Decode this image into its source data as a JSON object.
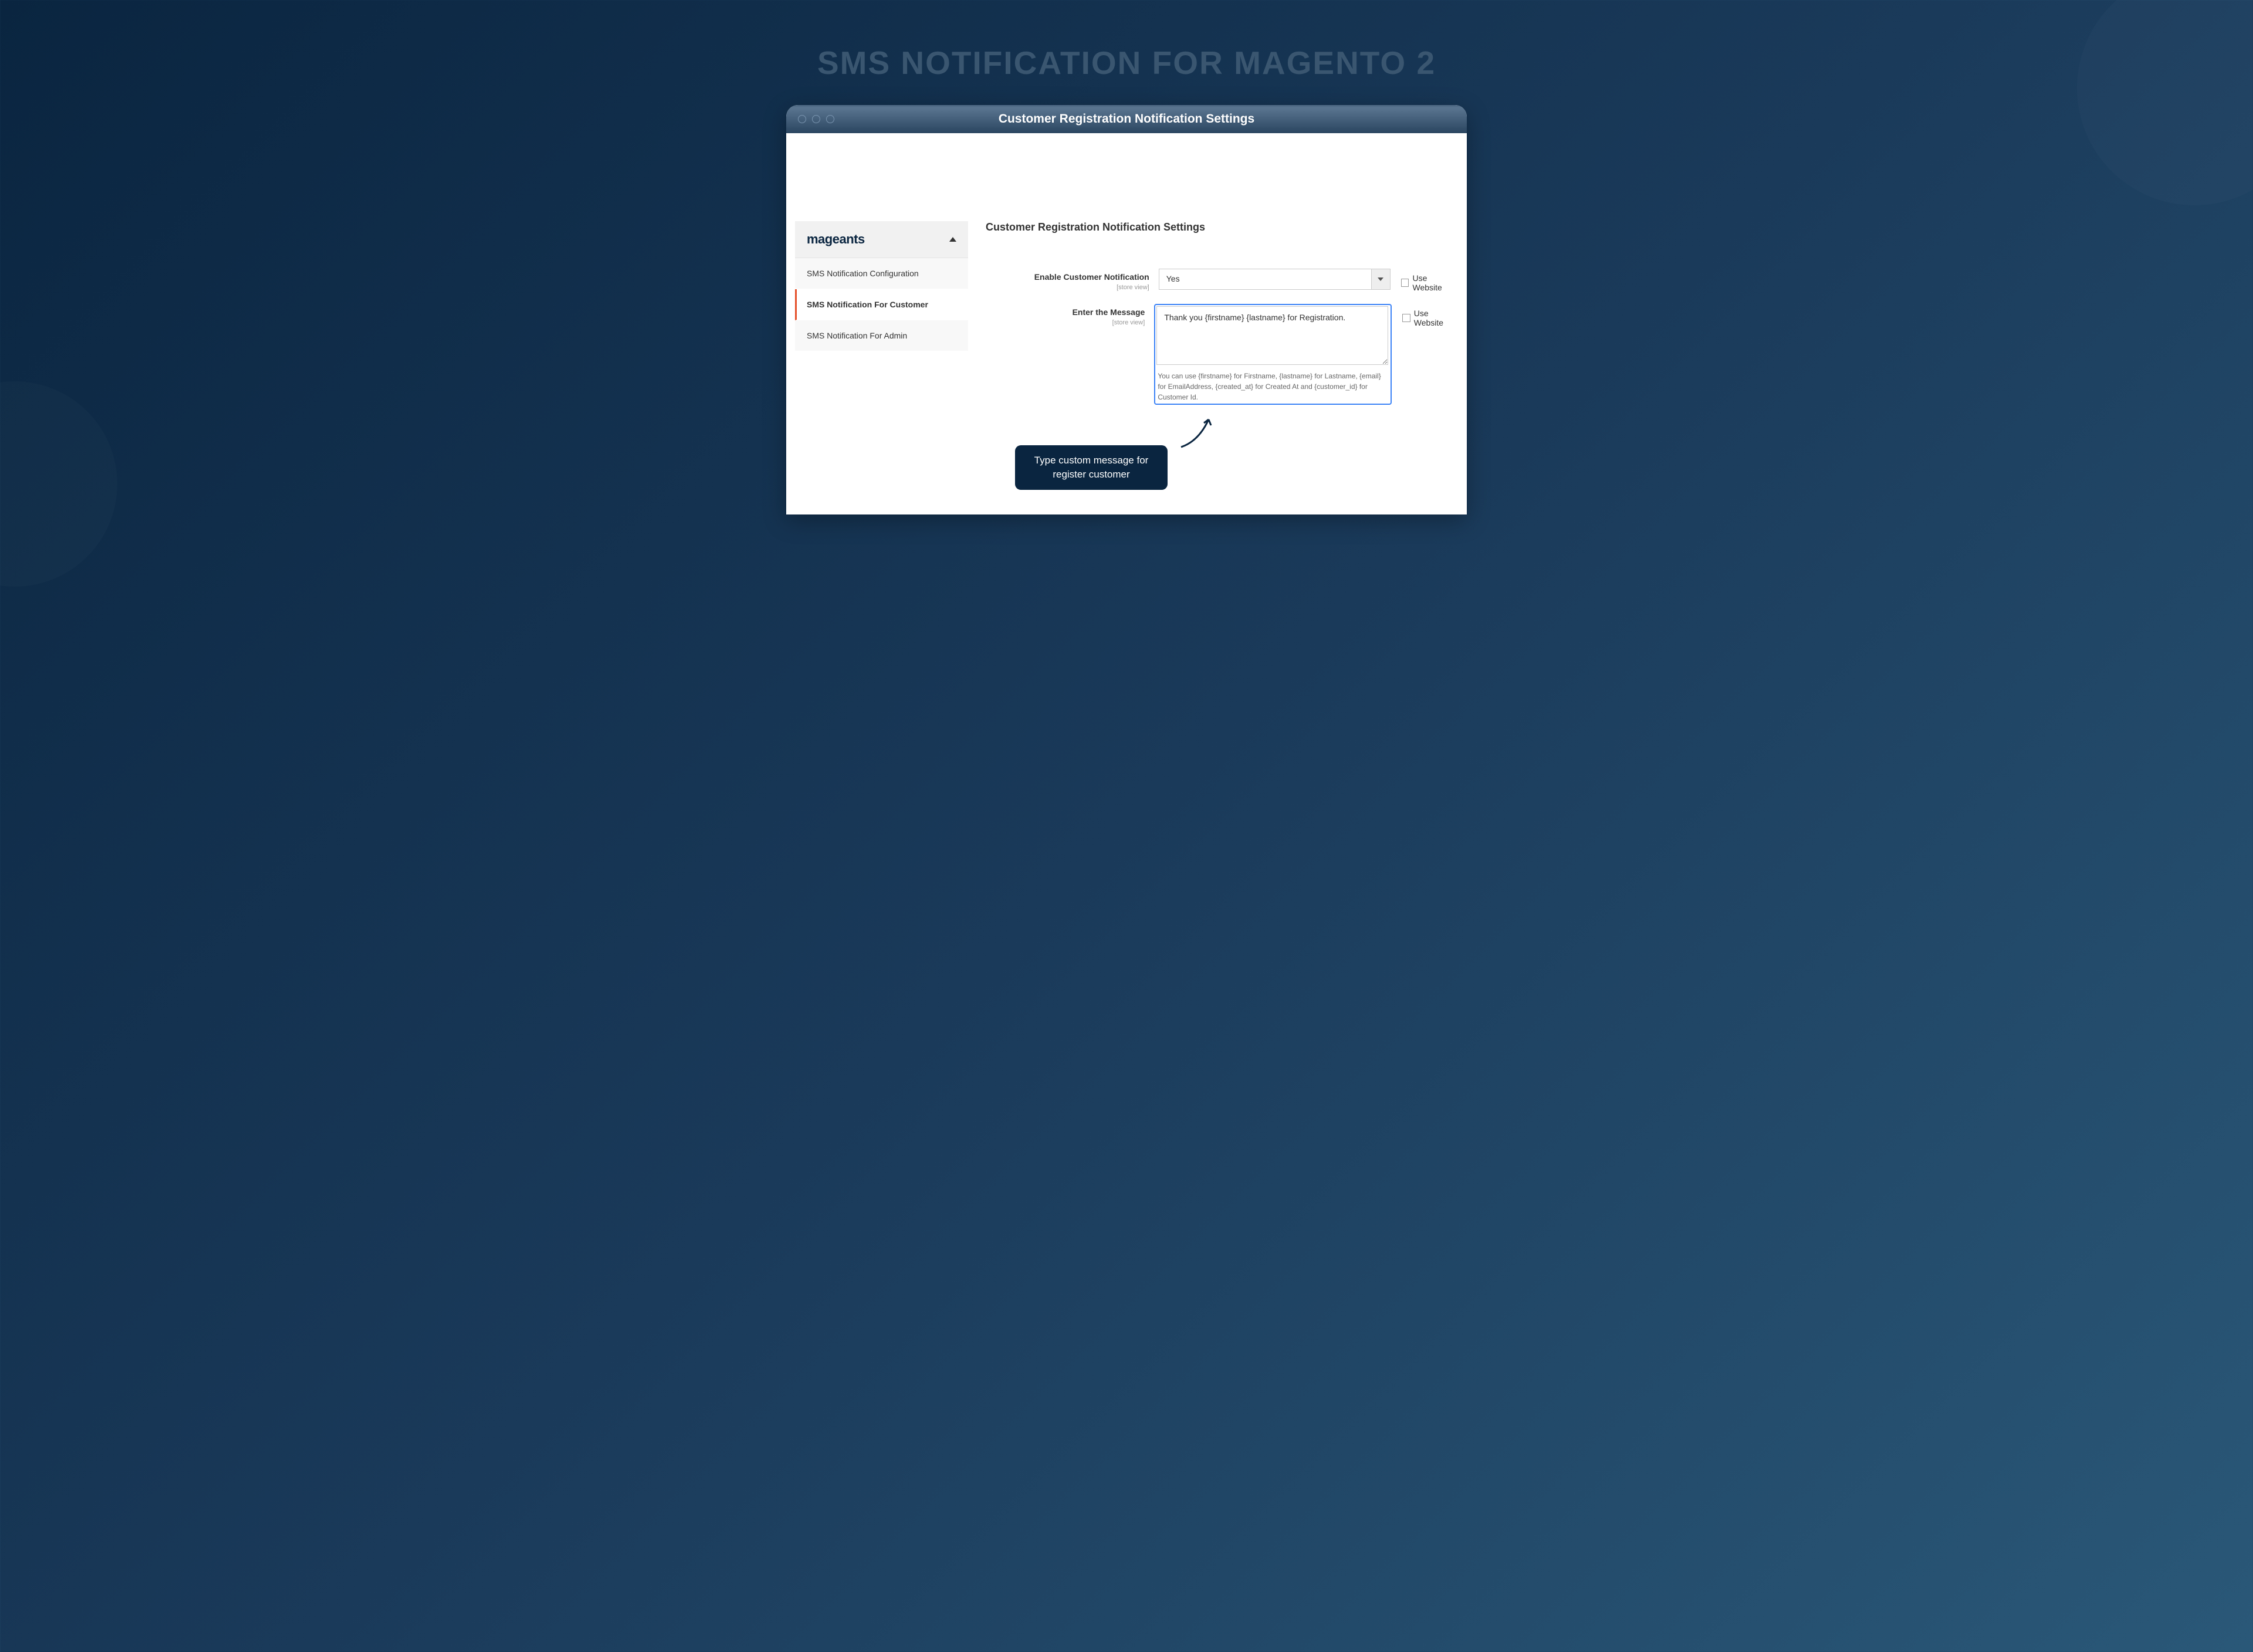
{
  "hero_title": "SMS NOTIFICATION FOR MAGENTO 2",
  "window_title": "Customer Registration Notification Settings",
  "brand": "mageants",
  "sidebar": {
    "items": [
      {
        "label": "SMS Notification Configuration"
      },
      {
        "label": "SMS Notification For Customer"
      },
      {
        "label": "SMS Notification For Admin"
      }
    ]
  },
  "section_heading": "Customer Registration Notification Settings",
  "fields": {
    "enable": {
      "label": "Enable Customer Notification",
      "scope": "[store view]",
      "value": "Yes",
      "use_website": "Use Website"
    },
    "message": {
      "label": "Enter the Message",
      "scope": "[store view]",
      "value": "Thank you {firstname} {lastname} for Registration.",
      "help": "You can use {firstname} for Firstname, {lastname} for Lastname, {email} for EmailAddress, {created_at} for Created At and {customer_id} for Customer Id.",
      "use_website": "Use Website"
    }
  },
  "callout_text": "Type custom message for register customer"
}
